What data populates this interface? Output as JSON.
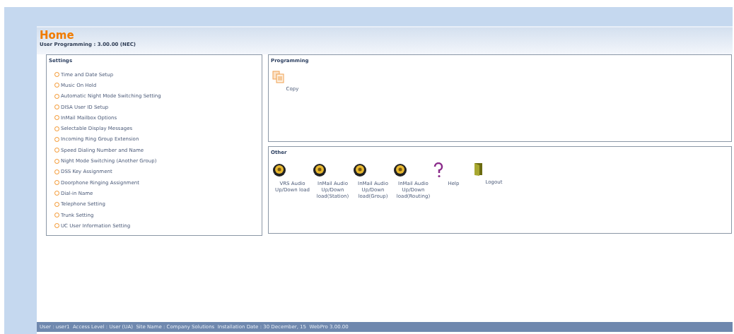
{
  "header": {
    "title": "Home",
    "subtitle": "User Programming : 3.00.00 (NEC)"
  },
  "settings": {
    "title": "Settings",
    "items": [
      "Time and Date Setup",
      "Music On Hold",
      "Automatic Night Mode Switching Setting",
      "DISA User ID Setup",
      "InMail Mailbox Options",
      "Selectable Display Messages",
      "Incoming Ring Group Extension",
      "Speed Dialing Number and Name",
      "Night Mode Switching (Another Group)",
      "DSS Key Assignment",
      "Doorphone Ringing Assignment",
      "Dial-in Name",
      "Telephone Setting",
      "Trunk Setting",
      "UC User Information Setting"
    ]
  },
  "programming": {
    "title": "Programming",
    "items": [
      {
        "kind": "copy",
        "lines": [
          "Copy"
        ]
      }
    ]
  },
  "other": {
    "title": "Other",
    "items": [
      {
        "kind": "speaker",
        "lines": [
          "VRS Audio",
          "Up/Down load"
        ]
      },
      {
        "kind": "speaker",
        "lines": [
          "InMail Audio",
          "Up/Down",
          "load(Station)"
        ]
      },
      {
        "kind": "speaker",
        "lines": [
          "InMail Audio",
          "Up/Down",
          "load(Group)"
        ]
      },
      {
        "kind": "speaker",
        "lines": [
          "InMail Audio",
          "Up/Down",
          "load(Routing)"
        ]
      },
      {
        "kind": "help",
        "lines": [
          "Help"
        ]
      },
      {
        "kind": "logout",
        "lines": [
          "Logout"
        ]
      }
    ]
  },
  "status_bar": "User : user1  Access Level : User (UA)  Site Name : Company Solutions  Installation Date : 30 December, 15  WebPro 3.00.00"
}
